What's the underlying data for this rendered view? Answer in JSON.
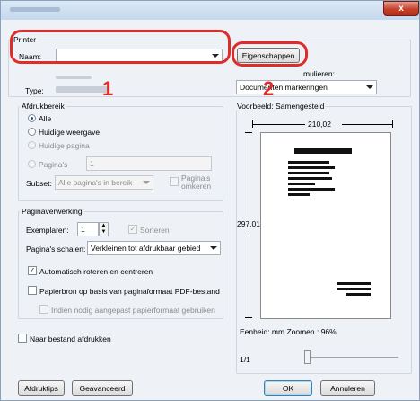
{
  "window": {
    "close_glyph": "x"
  },
  "printer_group": {
    "legend": "Printer",
    "name_label": "Naam:",
    "name_value": "",
    "type_label": "Type:",
    "properties_button": "Eigenschappen",
    "comments_label": "mulieren:",
    "comments_value": "Documenten markeringen"
  },
  "annotations": {
    "number_1": "1",
    "number_2": "2",
    "color": "#e02b2b"
  },
  "print_range": {
    "legend": "Afdrukbereik",
    "options": [
      "Alle",
      "Huidige weergave",
      "Huidige pagina",
      "Pagina's"
    ],
    "selected": "Alle",
    "pages_value": "1",
    "subset_label": "Subset:",
    "subset_value": "Alle pagina's in bereik",
    "reverse_label": "Pagina's omkeren"
  },
  "page_handling": {
    "legend": "Paginaverwerking",
    "copies_label": "Exemplaren:",
    "copies_value": "1",
    "collate_label": "Sorteren",
    "scaling_label": "Pagina's schalen:",
    "scaling_value": "Verkleinen tot afdrukbaar gebied",
    "auto_rotate_label": "Automatisch roteren en centreren",
    "paper_source_label": "Papierbron op basis van paginaformaat PDF-bestand",
    "custom_paper_label": "Indien nodig aangepast papierformaat gebruiken"
  },
  "print_to_file_label": "Naar bestand afdrukken",
  "preview": {
    "legend": "Voorbeeld: Samengesteld",
    "width_value": "210,02",
    "height_value": "297,01",
    "units_zoom": "Eenheid: mm Zoomen :  96%",
    "page_counter": "1/1"
  },
  "footer": {
    "tips_button": "Afdruktips",
    "advanced_button": "Geavanceerd",
    "ok_button": "OK",
    "cancel_button": "Annuleren"
  }
}
